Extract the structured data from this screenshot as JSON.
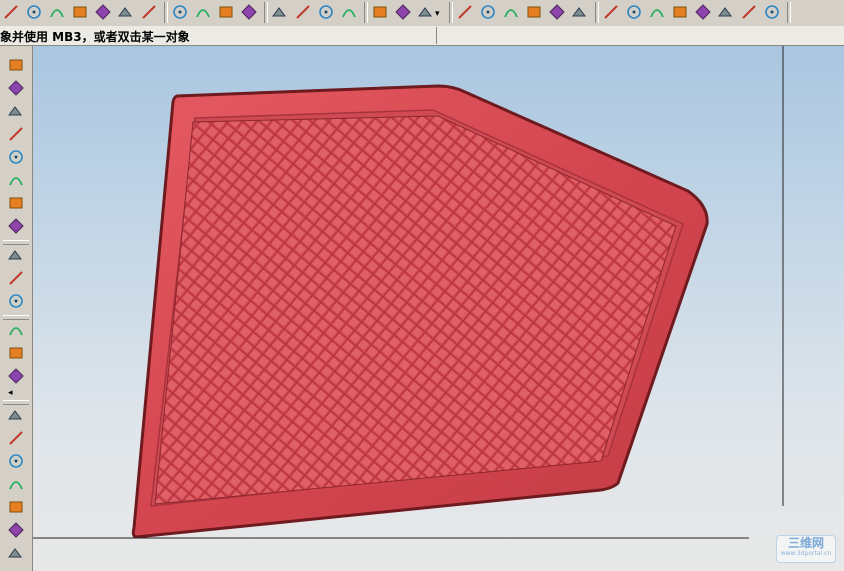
{
  "toolbar": {
    "icons": [
      "line-icon",
      "point-icon",
      "polyline-icon",
      "intersect-icon",
      "curve-icon",
      "spline-icon",
      "box-icon",
      "trim-icon",
      "trim-curve-icon",
      "corner-icon",
      "extend-icon",
      "circle-icon",
      "circle-center-icon",
      "circle-tangent-icon",
      "arc-icon",
      "center-point-icon",
      "quadrant-point-icon",
      "end-point-icon",
      "surface-icon",
      "boundary-surface-icon",
      "plane-icon",
      "face-icon",
      "sheet-icon",
      "offset-face-icon",
      "datum-icon",
      "axis-icon",
      "csys-icon",
      "view-icon",
      "layer-icon",
      "ruler-icon",
      "shading-icon",
      "color-icon",
      "render-icon"
    ],
    "snap_dropdown_label": "▾"
  },
  "cue_line": {
    "text": "象并使用 MB3，或者双击某一对象"
  },
  "left_toolbar": {
    "icons": [
      "extrude-icon",
      "revolve-icon",
      "sweep-icon",
      "hole-icon",
      "block-icon",
      "cylinder-icon",
      "cone-icon",
      "blend-icon",
      "unite-icon",
      "subtract-icon",
      "intersect-body-icon",
      "chamfer-icon",
      "shell-icon",
      "draft-icon",
      "pattern-icon",
      "mirror-icon",
      "offset-icon",
      "scale-icon",
      "thicken-icon",
      "trim-body-icon",
      "split-icon"
    ],
    "collapse_label": "◂"
  },
  "viewport": {
    "model_name": "grille-mesh-panel",
    "colors": {
      "part_fill": "#d24a54",
      "part_edge": "#6e1a1e",
      "mesh_line": "#b4323c",
      "background_top": "#a9c6e0",
      "background_bottom": "#e8e8e8"
    }
  },
  "watermark": {
    "main": "三维网",
    "sub": "www.3dportal.cn"
  }
}
